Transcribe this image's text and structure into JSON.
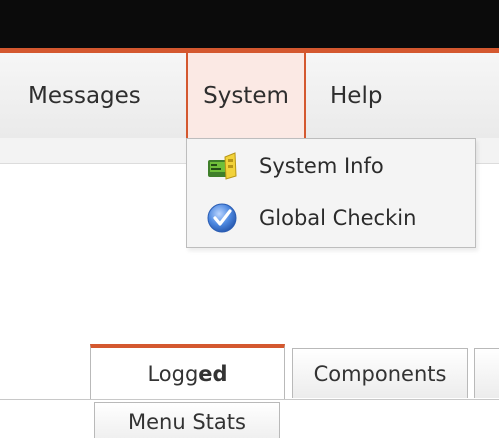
{
  "menubar": {
    "items": [
      {
        "label": "Messages"
      },
      {
        "label": "System"
      },
      {
        "label": "Help"
      }
    ]
  },
  "dropdown": {
    "items": [
      {
        "label": "System Info",
        "icon": "system-info-icon"
      },
      {
        "label": "Global Checkin",
        "icon": "checkmark-circle-icon"
      }
    ]
  },
  "tabs": {
    "active_prefix": "Logg",
    "active_bold": "ed",
    "components": "Components"
  },
  "subtabs": {
    "menu_stats": "Menu Stats"
  },
  "colors": {
    "accent": "#d4582f",
    "topbar": "#0b0b0b"
  }
}
